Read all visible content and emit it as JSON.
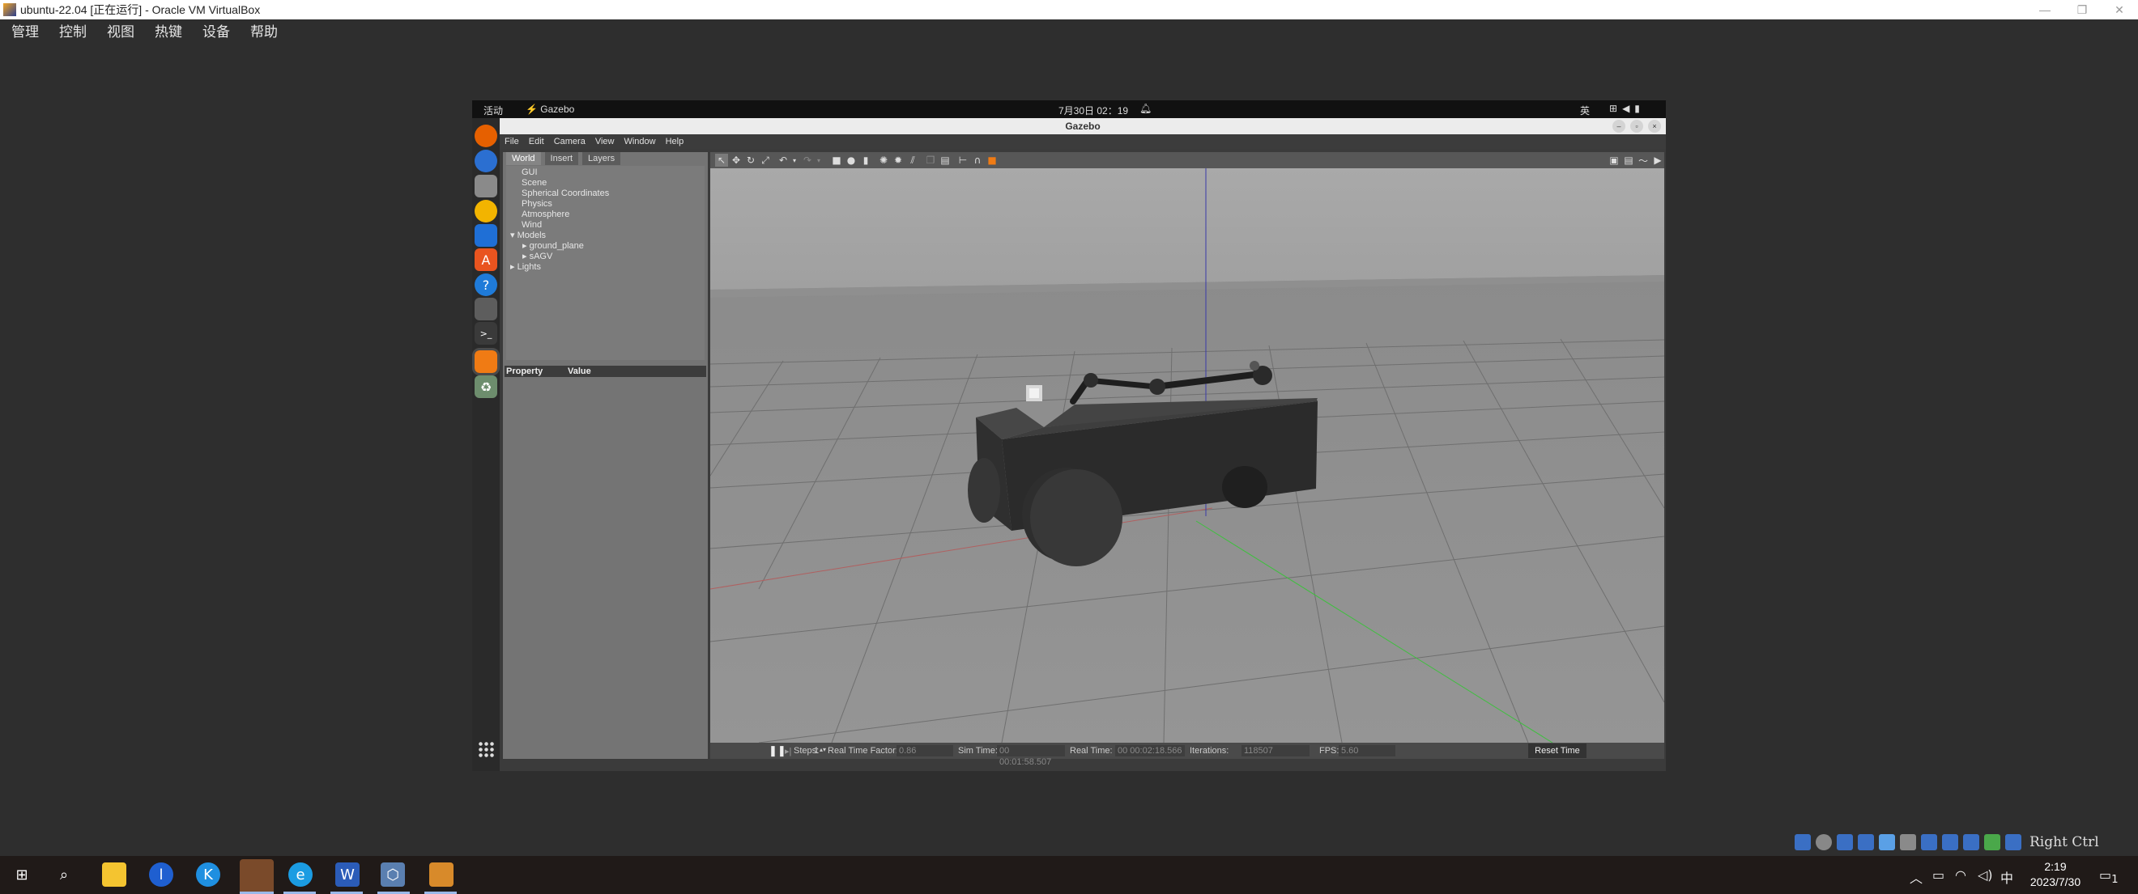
{
  "host": {
    "window_title": "ubuntu-22.04 [正在运行] - Oracle VM VirtualBox",
    "window_controls": [
      "—",
      "❐",
      "✕"
    ],
    "menu": [
      "管理",
      "控制",
      "视图",
      "热键",
      "设备",
      "帮助"
    ],
    "host_key_label": "Right Ctrl"
  },
  "guest": {
    "topbar": {
      "activities": "活动",
      "app_name": "Gazebo",
      "clock": "7月30日 02：19",
      "input_method": "英"
    },
    "dock_apps": [
      {
        "name": "firefox",
        "glyph": "",
        "color": "#e66000"
      },
      {
        "name": "thunderbird",
        "glyph": "",
        "color": "#2b6fd1"
      },
      {
        "name": "files",
        "glyph": "",
        "color": "#8a8a8a"
      },
      {
        "name": "rhythmbox",
        "glyph": "",
        "color": "#f2b400"
      },
      {
        "name": "writer",
        "glyph": "",
        "color": "#1f6fd6"
      },
      {
        "name": "app-center",
        "glyph": "A",
        "color": "#e9541f"
      },
      {
        "name": "help",
        "glyph": "?",
        "color": "#1f7bd9"
      },
      {
        "name": "chat",
        "glyph": "",
        "color": "#5d5d5d"
      },
      {
        "name": "terminal",
        "glyph": ">_",
        "color": "#3a3a3a"
      },
      {
        "name": "gazebo",
        "glyph": "",
        "color": "#f07b14"
      },
      {
        "name": "trash",
        "glyph": "♻",
        "color": "#6d8d6d"
      }
    ]
  },
  "gazebo": {
    "title": "Gazebo",
    "menu": [
      "File",
      "Edit",
      "Camera",
      "View",
      "Window",
      "Help"
    ],
    "tabs": [
      "World",
      "Insert",
      "Layers"
    ],
    "tree": [
      "GUI",
      "Scene",
      "Spherical Coordinates",
      "Physics",
      "Atmosphere",
      "Wind",
      "Models",
      "ground_plane",
      "sAGV",
      "Lights"
    ],
    "property_header": {
      "property": "Property",
      "value": "Value"
    },
    "bottom": {
      "steps_label": "Steps:",
      "steps_value": "1",
      "rtf_label": "Real Time Factor:",
      "rtf_value": "0.86",
      "sim_time_label": "Sim Time:",
      "sim_time_value": "00 00:01:58.507",
      "real_time_label": "Real Time:",
      "real_time_value": "00 00:02:18.566",
      "iterations_label": "Iterations:",
      "iterations_value": "118507",
      "fps_label": "FPS:",
      "fps_value": "5.60",
      "reset_label": "Reset Time"
    }
  },
  "taskbar": {
    "time": "2:19",
    "date": "2023/7/30",
    "ime": "中",
    "notifications": "1"
  }
}
